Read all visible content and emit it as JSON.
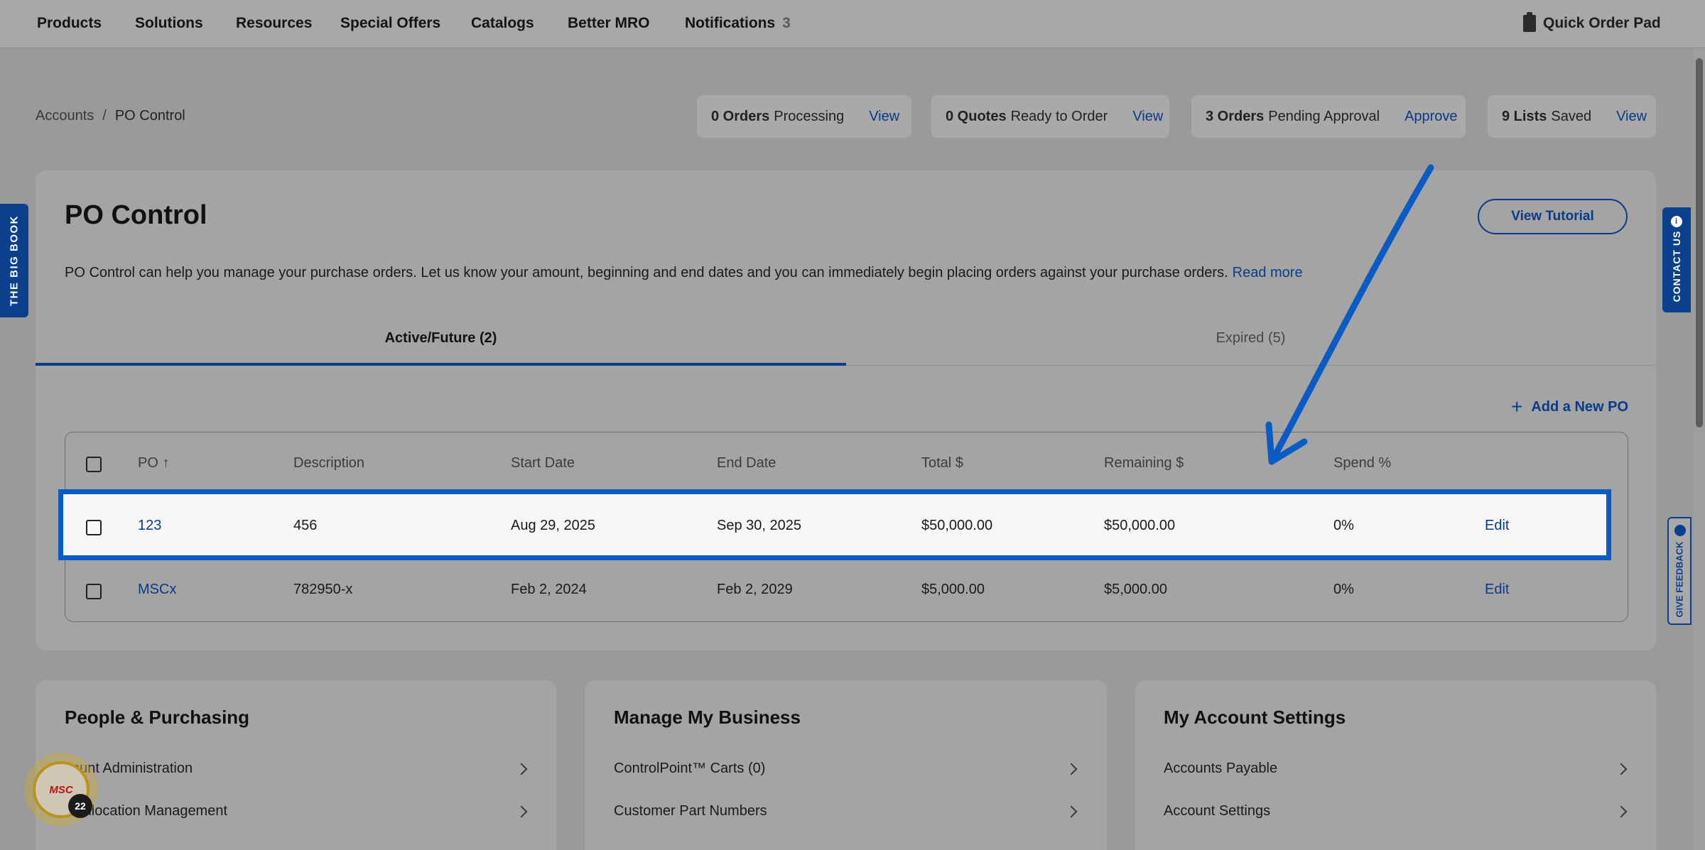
{
  "nav": {
    "items": [
      "Products",
      "Solutions",
      "Resources",
      "Special Offers",
      "Catalogs",
      "Better MRO",
      "Notifications"
    ],
    "notifications_count": "3",
    "quick_order_pad": "Quick Order Pad"
  },
  "breadcrumb": {
    "root": "Accounts",
    "sep": "/",
    "current": "PO Control"
  },
  "status": [
    {
      "bold": "0 Orders",
      "text": "Processing",
      "link": "View"
    },
    {
      "bold": "0 Quotes",
      "text": "Ready to Order",
      "link": "View"
    },
    {
      "bold": "3 Orders",
      "text": "Pending Approval",
      "link": "Approve"
    },
    {
      "bold": "9 Lists",
      "text": "Saved",
      "link": "View"
    }
  ],
  "page": {
    "title": "PO Control",
    "tutorial_button": "View Tutorial",
    "intro": "PO Control can help you manage your purchase orders. Let us know your amount, beginning and end dates and you can immediately begin placing orders against your purchase orders.",
    "read_more": "Read more"
  },
  "tabs": {
    "active": "Active/Future (2)",
    "expired": "Expired (5)"
  },
  "add_po": "Add a New PO",
  "table": {
    "headers": [
      "PO",
      "Description",
      "Start Date",
      "End Date",
      "Total $",
      "Remaining $",
      "Spend %"
    ],
    "sort_icon": "↑",
    "rows": [
      {
        "po": "123",
        "description": "456",
        "start": "Aug 29, 2025",
        "end": "Sep 30, 2025",
        "total": "$50,000.00",
        "remaining": "$50,000.00",
        "spend": "0%",
        "action": "Edit"
      },
      {
        "po": "MSCx",
        "description": "782950-x",
        "start": "Feb 2, 2024",
        "end": "Feb 2, 2029",
        "total": "$5,000.00",
        "remaining": "$5,000.00",
        "spend": "0%",
        "action": "Edit"
      }
    ]
  },
  "sections": [
    {
      "title": "People & Purchasing",
      "items": [
        "count Administration",
        "st Allocation Management"
      ]
    },
    {
      "title": "Manage My Business",
      "items": [
        "ControlPoint™ Carts (0)",
        "Customer Part Numbers"
      ]
    },
    {
      "title": "My Account Settings",
      "items": [
        "Accounts Payable",
        "Account Settings"
      ]
    }
  ],
  "side": {
    "big_book": "THE BIG BOOK",
    "contact": "CONTACT US",
    "feedback": "GIVE FEEDBACK"
  },
  "msc": {
    "logo": "MSC",
    "count": "22"
  },
  "colors": {
    "brand_blue": "#0b3a86",
    "highlight": "#0b5bc4"
  }
}
